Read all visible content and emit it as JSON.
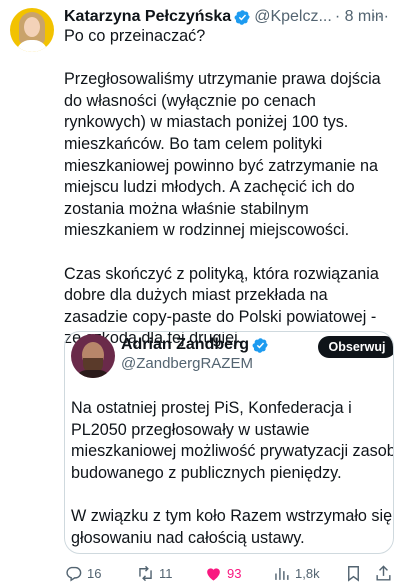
{
  "tweet": {
    "author_name": "Katarzyna Pełczyńska",
    "author_handle": "@Kpelcz...",
    "time": "· 8 min",
    "more_label": "···",
    "text": "Po co przeinaczać?\n\nPrzegłosowaliśmy utrzymanie prawa dojścia do własności (wyłącznie po cenach rynkowych) w miastach poniżej 100 tys. mieszkańców. Bo tam celem polityki mieszkaniowej powinno być zatrzymanie na miejscu ludzi młodych. A zachęcić ich do zostania można właśnie stabilnym mieszkaniem w rodzinnej miejscowości.\n\nCzas skończyć z polityką, która rozwiązania dobre dla dużych miast przekłada na zasadzie copy-paste do Polski powiatowej - ze szkodą dla tej drugiej."
  },
  "quoted": {
    "author_name": "Adrian Zandberg",
    "author_handle": "@ZandbergRAZEM",
    "follow_label": "Obserwuj",
    "text": "Na ostatniej prostej PiS, Konfederacja i PL2050 przegłosowały w ustawie mieszkaniowej możliwość prywatyzacji zasobu budowanego z publicznych pieniędzy.\n\nW związku z tym koło Razem wstrzymało się w głosowaniu nad całością ustawy."
  },
  "actions": {
    "replies": "16",
    "retweets": "11",
    "likes": "93",
    "views": "1,8k"
  },
  "colors": {
    "verified": "#1d9bf0",
    "like": "#f91880",
    "muted": "#536471"
  },
  "icons": [
    "verified-badge-icon",
    "reply-icon",
    "retweet-icon",
    "heart-icon",
    "views-icon",
    "bookmark-icon",
    "share-icon"
  ]
}
